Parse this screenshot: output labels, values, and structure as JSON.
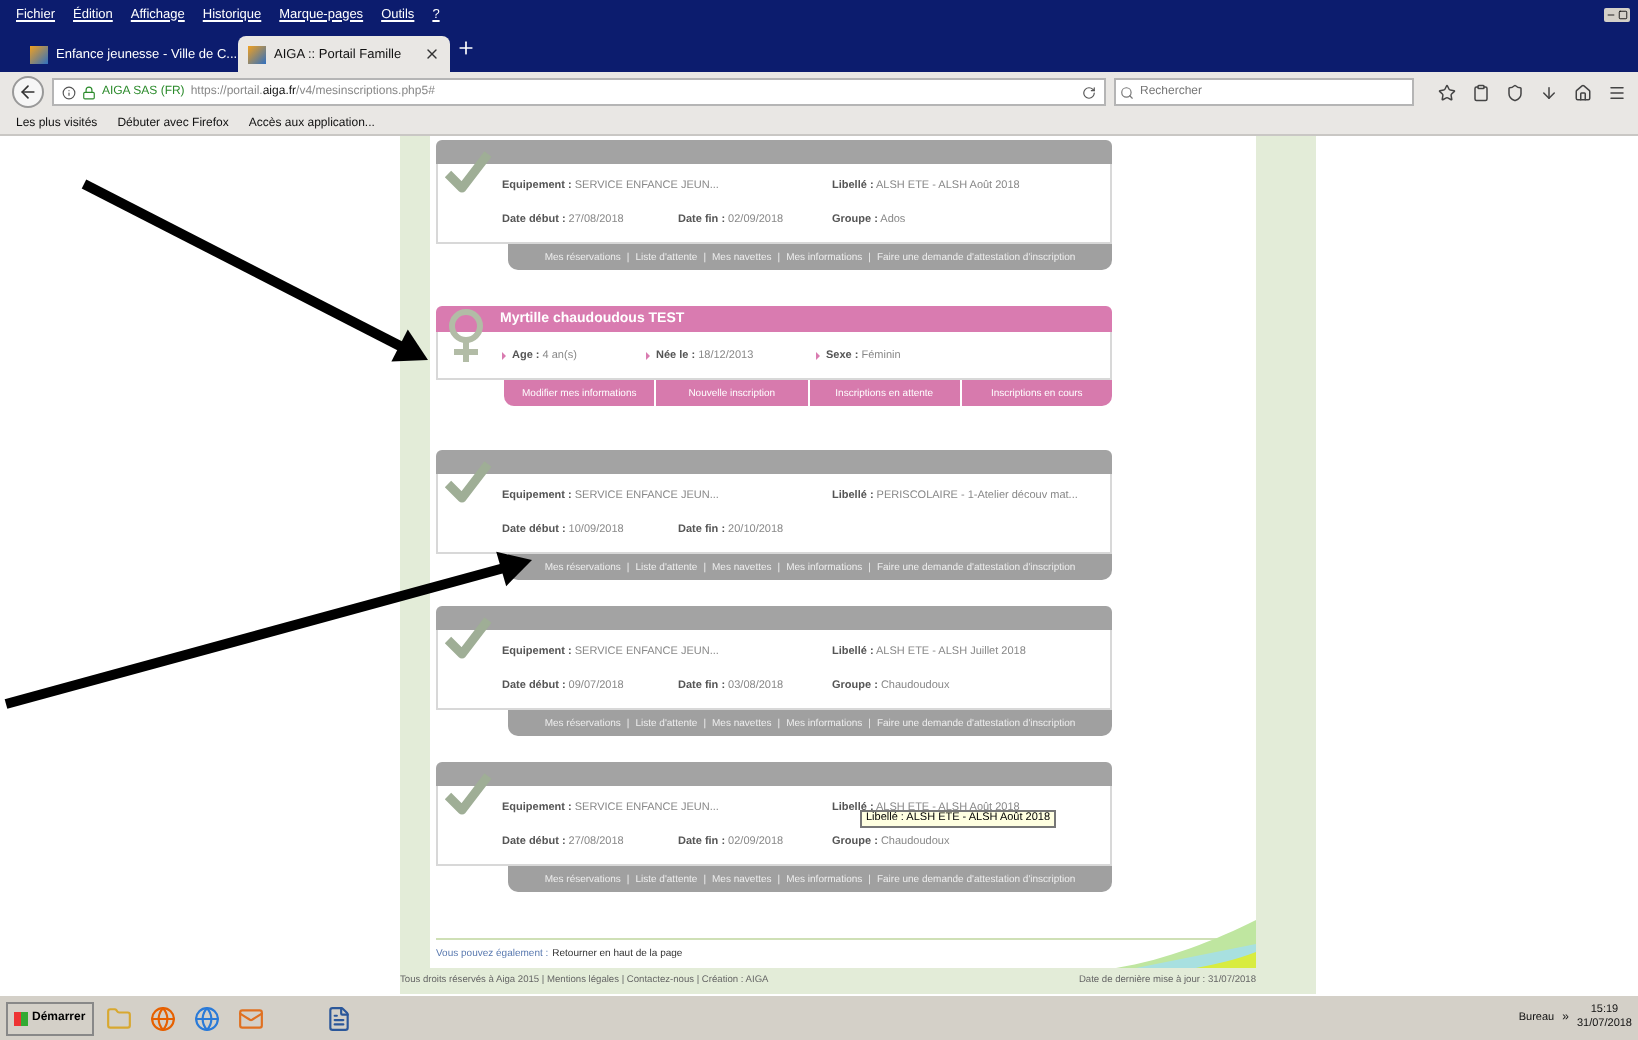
{
  "browser": {
    "menu": [
      "Fichier",
      "Édition",
      "Affichage",
      "Historique",
      "Marque-pages",
      "Outils",
      "?"
    ],
    "tabs": [
      {
        "label": "Enfance jeunesse - Ville de C...",
        "selected": false
      },
      {
        "label": "AIGA :: Portail Famille",
        "selected": true
      }
    ],
    "site_identity": "AIGA SAS (FR)",
    "url": "https://portail.**aiga.fr**/v4/mesinscriptions.php5#",
    "search": {
      "placeholder": "Rechercher"
    },
    "bookmarks": [
      "Les plus visités",
      "Débuter avec Firefox",
      "Accès aux application..."
    ]
  },
  "page": {
    "link_separator": "|",
    "cards": [
      {
        "kind": "inscription",
        "rows": [
          [
            "**Equipement :** SERVICE ENFANCE JEUN...",
            "",
            "**Libellé :** ALSH ETE - ALSH Août 2018"
          ],
          [
            "**Date début :** 27/08/2018",
            "**Date fin :** 02/09/2018",
            "**Groupe :** Ados"
          ]
        ],
        "links": [
          "Mes réservations",
          "Liste d'attente",
          "Mes navettes",
          "Mes informations",
          "Faire une demande d'attestation d'inscription"
        ]
      },
      {
        "kind": "child",
        "name": "Myrtille chaudoudous TEST",
        "facts": [
          "**Age :** 4 an(s)",
          "**Née le :** 18/12/2013",
          "**Sexe :** Féminin"
        ],
        "actions": [
          "Modifier mes informations",
          "Nouvelle inscription",
          "Inscriptions en attente",
          "Inscriptions en cours"
        ]
      },
      {
        "kind": "inscription",
        "rows": [
          [
            "**Equipement :** SERVICE ENFANCE JEUN...",
            "",
            "**Libellé :** PERISCOLAIRE - 1-Atelier découv mat..."
          ],
          [
            "**Date début :** 10/09/2018",
            "**Date fin :** 20/10/2018"
          ]
        ],
        "links": [
          "Mes réservations",
          "Liste d'attente",
          "Mes navettes",
          "Mes informations",
          "Faire une demande d'attestation d'inscription"
        ]
      },
      {
        "kind": "inscription",
        "rows": [
          [
            "**Equipement :** SERVICE ENFANCE JEUN...",
            "",
            "**Libellé :** ALSH ETE - ALSH Juillet 2018"
          ],
          [
            "**Date début :** 09/07/2018",
            "**Date fin :** 03/08/2018",
            "**Groupe :** Chaudoudoux"
          ]
        ],
        "links": [
          "Mes réservations",
          "Liste d'attente",
          "Mes navettes",
          "Mes informations",
          "Faire une demande d'attestation d'inscription"
        ]
      },
      {
        "kind": "inscription",
        "rows": [
          [
            "**Equipement :** SERVICE ENFANCE JEUN...",
            "",
            "**Libellé :** ALSH ETE - ALSH Août 2018"
          ],
          [
            "**Date début :** 27/08/2018",
            "**Date fin :** 02/09/2018",
            "**Groupe :** Chaudoudoux"
          ]
        ],
        "links": [
          "Mes réservations",
          "Liste d'attente",
          "Mes navettes",
          "Mes informations",
          "Faire une demande d'attestation d'inscription"
        ],
        "tooltip": "Libellé : ALSH ETE - ALSH Août 2018"
      }
    ],
    "also": {
      "label": "Vous pouvez également :",
      "link": "Retourner en haut de la page"
    },
    "footer": {
      "left": "Tous droits réservés à Aiga 2015 | Mentions légales | Contactez-nous | Création : AIGA",
      "right": "Date de dernière mise à jour : 31/07/2018"
    }
  },
  "taskbar": {
    "start": "Démarrer",
    "toolbar_label": "Bureau",
    "overflow": "»",
    "time": "15:19",
    "date": "31/07/2018"
  }
}
